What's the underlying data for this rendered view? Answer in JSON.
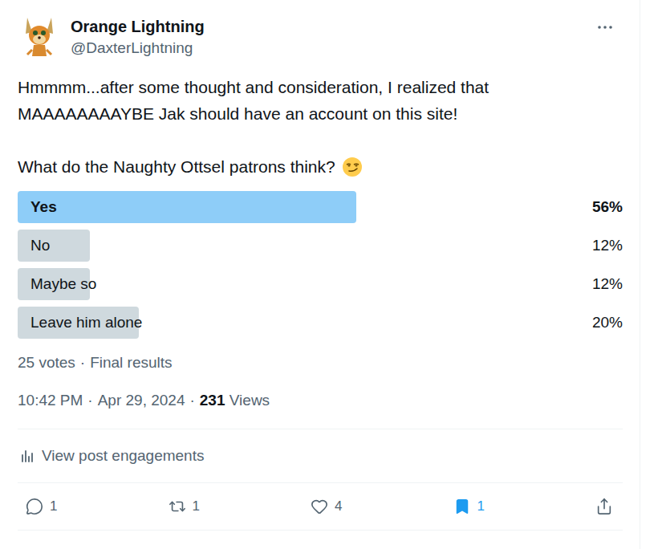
{
  "author": {
    "name": "Orange Lightning",
    "handle": "@DaxterLightning"
  },
  "post": {
    "paragraphs": [
      "Hmmmm...after some thought and consideration, I realized that MAAAAAAAAYBE Jak should have an account on this site!",
      "What do the Naughty Ottsel patrons think?"
    ]
  },
  "poll": {
    "options": [
      {
        "label": "Yes",
        "percent": "56%",
        "level": 0.56,
        "winner": true
      },
      {
        "label": "No",
        "percent": "12%",
        "level": 0.12,
        "winner": false
      },
      {
        "label": "Maybe so",
        "percent": "12%",
        "level": 0.12,
        "winner": false
      },
      {
        "label": "Leave him alone",
        "percent": "20%",
        "level": 0.2,
        "winner": false
      }
    ],
    "votes": "25 votes",
    "separator": "·",
    "status": "Final results"
  },
  "meta": {
    "time": "10:42 PM",
    "separator": "·",
    "date": "Apr 29, 2024",
    "views": "231",
    "views_label": "Views"
  },
  "engagements": "View post engagements",
  "actions": [
    {
      "name": "reply",
      "count": "1",
      "active": false
    },
    {
      "name": "repost",
      "count": "1",
      "active": false
    },
    {
      "name": "like",
      "count": "4",
      "active": false
    },
    {
      "name": "bookmark",
      "count": "1",
      "active": true
    },
    {
      "name": "share",
      "count": "",
      "active": false
    }
  ]
}
